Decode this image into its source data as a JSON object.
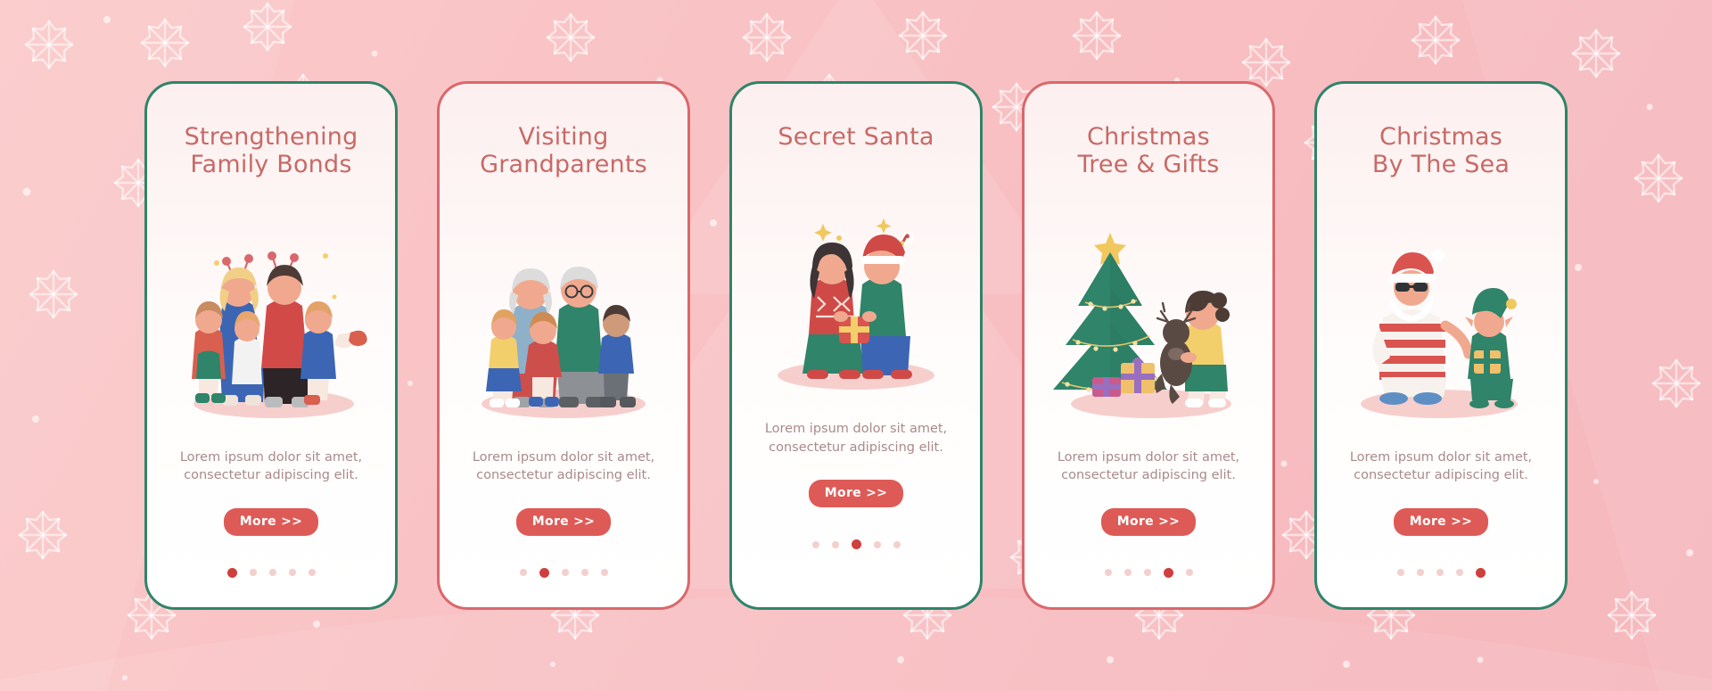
{
  "background": {
    "color_start": "#fbc9c9",
    "color_end": "#f5b8bd",
    "decor": "snowflakes-and-dots"
  },
  "theme": {
    "border_green": "#2f8469",
    "border_red": "#d9686c",
    "title_color": "#c86a66",
    "body_color": "#a98a8c",
    "button_bg": "#de5a56",
    "button_text": "#ffffff",
    "dot_inactive": "#f3cfce",
    "dot_active": "#cf3f3c"
  },
  "screens": [
    {
      "title": "Strengthening\nFamily Bonds",
      "body": "Lorem ipsum dolor sit amet,\nconsectetur adipiscing elit.",
      "button_label": "More >>",
      "border_style": "green",
      "illustration": "family-hugging",
      "dots_total": 5,
      "dots_active_index": 0
    },
    {
      "title": "Visiting\nGrandparents",
      "body": "Lorem ipsum dolor sit amet,\nconsectetur adipiscing elit.",
      "button_label": "More >>",
      "border_style": "red",
      "illustration": "grandparents-and-grandchildren",
      "dots_total": 5,
      "dots_active_index": 1
    },
    {
      "title": "Secret Santa",
      "body": "Lorem ipsum dolor sit amet,\nconsectetur adipiscing elit.",
      "button_label": "More >>",
      "border_style": "green",
      "illustration": "couple-exchanging-gift",
      "dots_total": 5,
      "dots_active_index": 2
    },
    {
      "title": "Christmas\nTree & Gifts",
      "body": "Lorem ipsum dolor sit amet,\nconsectetur adipiscing elit.",
      "button_label": "More >>",
      "border_style": "red",
      "illustration": "christmas-tree-girl-with-presents",
      "dots_total": 5,
      "dots_active_index": 3
    },
    {
      "title": "Christmas\nBy The Sea",
      "body": "Lorem ipsum dolor sit amet,\nconsectetur adipiscing elit.",
      "button_label": "More >>",
      "border_style": "green",
      "illustration": "beach-santa-and-elf",
      "dots_total": 5,
      "dots_active_index": 4
    }
  ]
}
